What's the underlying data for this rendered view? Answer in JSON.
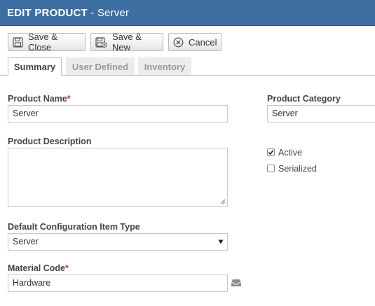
{
  "window": {
    "title_prefix": "EDIT PRODUCT",
    "title_suffix": " - Server"
  },
  "toolbar": {
    "save_close_label": "Save & Close",
    "save_new_label": "Save & New",
    "cancel_label": "Cancel"
  },
  "tabs": [
    {
      "label": "Summary",
      "active": true
    },
    {
      "label": "User Defined",
      "active": false
    },
    {
      "label": "Inventory",
      "active": false
    }
  ],
  "form": {
    "product_name": {
      "label": "Product Name",
      "required_mark": "*",
      "value": "Server"
    },
    "product_category": {
      "label": "Product Category",
      "value": "Server"
    },
    "product_description": {
      "label": "Product Description",
      "value": ""
    },
    "active": {
      "label": "Active",
      "checked": true
    },
    "serialized": {
      "label": "Serialized",
      "checked": false
    },
    "config_item_type": {
      "label": "Default Configuration Item Type",
      "value": "Server"
    },
    "material_code": {
      "label": "Material Code",
      "required_mark": "*",
      "value": "Hardware"
    }
  },
  "icons": {
    "save_close": "floppy-disk-icon",
    "save_new": "floppy-disk-plus-icon",
    "cancel": "cancel-circle-icon",
    "dropdown": "triangle-down-icon",
    "picker": "inbox-tray-icon",
    "checkmark": "checkmark-icon"
  },
  "colors": {
    "titlebar": "#3d6ea1",
    "required": "#c0392b"
  }
}
